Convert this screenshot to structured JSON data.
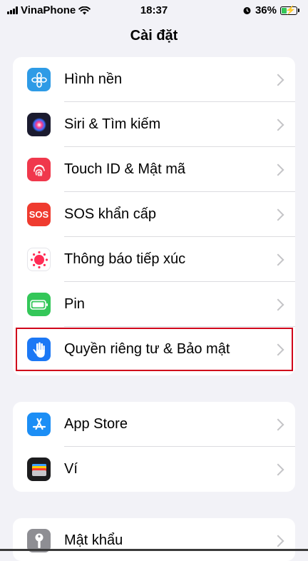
{
  "status_bar": {
    "carrier": "VinaPhone",
    "time": "18:37",
    "battery_percent": "36%",
    "battery_level": 0.36,
    "icons": [
      "signal-bars-icon",
      "wifi-icon",
      "alarm-icon",
      "battery-charging-icon"
    ]
  },
  "nav": {
    "title": "Cài đặt"
  },
  "groups": [
    {
      "items": [
        {
          "label": "Hình nền",
          "icon": "wallpaper-flower-icon",
          "color": "#2e9be6"
        },
        {
          "label": "Siri & Tìm kiếm",
          "icon": "siri-icon",
          "color": "#1b1b2f"
        },
        {
          "label": "Touch ID & Mật mã",
          "icon": "fingerprint-icon",
          "color": "#f0384c"
        },
        {
          "label": "SOS khẩn cấp",
          "icon": "sos-icon",
          "color": "#ef3b2f",
          "icon_text": "SOS"
        },
        {
          "label": "Thông báo tiếp xúc",
          "icon": "exposure-notification-icon",
          "color": "#ffffff"
        },
        {
          "label": "Pin",
          "icon": "battery-icon",
          "color": "#34c759"
        },
        {
          "label": "Quyền riêng tư & Bảo mật",
          "icon": "privacy-hand-icon",
          "color": "#1c78f5",
          "highlighted": true
        }
      ]
    },
    {
      "items": [
        {
          "label": "App Store",
          "icon": "app-store-icon",
          "color": "#1c8ef5"
        },
        {
          "label": "Ví",
          "icon": "wallet-icon",
          "color": "#1c1c1e"
        }
      ]
    },
    {
      "items": [
        {
          "label": "Mật khẩu",
          "icon": "key-icon",
          "color": "#8e8e93"
        }
      ]
    }
  ],
  "highlight_color": "#d0021b"
}
